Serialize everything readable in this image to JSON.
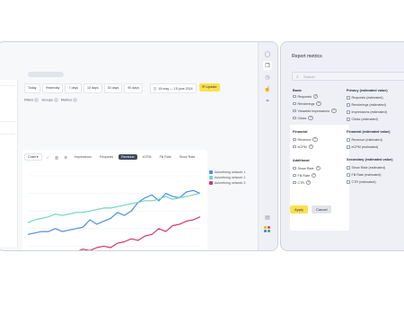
{
  "toolbar": {
    "presets": [
      "Today",
      "Yesterday",
      "7 days",
      "14 days",
      "30 days",
      "90 days"
    ],
    "date_range": "15 may — 15 june 2024",
    "update_label": "Update"
  },
  "filters": {
    "filters_label": "Filters",
    "groups_label": "Groups",
    "metrics_label": "Metrics"
  },
  "report": {
    "chart_label": "Chart",
    "tabs": [
      "Impressions",
      "Requests",
      "Revenue",
      "eCPM",
      "Fill Rate",
      "Show Rate"
    ],
    "active_tab": "Revenue"
  },
  "chart_data": {
    "type": "line",
    "colors": [
      "#4a90e2",
      "#6fd6c4",
      "#d6336c"
    ],
    "series": [
      {
        "name": "Advertising network 1",
        "values": [
          20,
          21,
          22,
          22,
          24,
          22,
          23,
          24,
          25,
          30,
          27,
          29,
          31,
          35,
          33,
          36,
          42,
          45,
          47,
          43,
          48,
          46,
          45,
          49,
          50,
          48
        ]
      },
      {
        "name": "Advertising network 2",
        "values": [
          28,
          30,
          31,
          32,
          34,
          33,
          34,
          35,
          35,
          36,
          37,
          38,
          38,
          39,
          40,
          41,
          42,
          43,
          43,
          44,
          46,
          44,
          45,
          46,
          47,
          48
        ]
      },
      {
        "name": "Advertising network 3",
        "values": [
          4,
          5,
          6,
          6,
          7,
          6,
          7,
          8,
          10,
          9,
          11,
          12,
          11,
          14,
          15,
          17,
          16,
          19,
          20,
          24,
          22,
          26,
          27,
          29,
          30,
          32
        ]
      }
    ],
    "xlabel": "",
    "ylabel": "",
    "ylim": [
      0,
      60
    ],
    "grid": true,
    "legend": "right"
  },
  "modal": {
    "title": "Report metrics",
    "search_placeholder": "Search",
    "apply_label": "Apply",
    "cancel_label": "Cancel",
    "basic": {
      "title": "Basic",
      "items": [
        "Requests",
        "Renderings",
        "Viewable impressions",
        "Clicks"
      ]
    },
    "financial": {
      "title": "Financial",
      "items": [
        "Revenue",
        "eCPM"
      ]
    },
    "additional": {
      "title": "Additional",
      "items": [
        "Show Rate",
        "Fill Rate",
        "CTR"
      ]
    },
    "privacy": {
      "title": "Privacy (estimated value)",
      "items": [
        "Requests (estimated)",
        "Renderings (estimated)",
        "Impressions (estimated)",
        "Clicks (estimated)"
      ]
    },
    "financial_est": {
      "title": "Financial (estimated value)",
      "items": [
        "Revenue (estimated)",
        "eCPM (estimated)"
      ]
    },
    "secondary": {
      "title": "Secondary (estimated value)",
      "items": [
        "Show Rate (estimated)",
        "Fill Rate (estimated)",
        "CTR (estimated)"
      ]
    }
  }
}
